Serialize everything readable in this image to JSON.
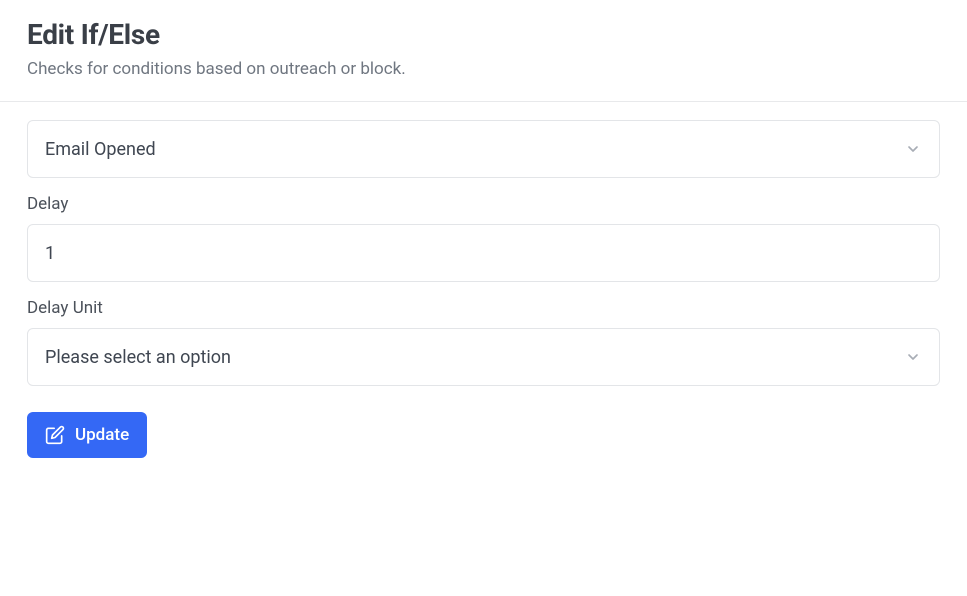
{
  "header": {
    "title": "Edit If/Else",
    "subtitle": "Checks for conditions based on outreach or block."
  },
  "condition": {
    "selected": "Email Opened"
  },
  "delay": {
    "label": "Delay",
    "value": "1"
  },
  "delayUnit": {
    "label": "Delay Unit",
    "placeholder": "Please select an option"
  },
  "actions": {
    "update": "Update"
  }
}
